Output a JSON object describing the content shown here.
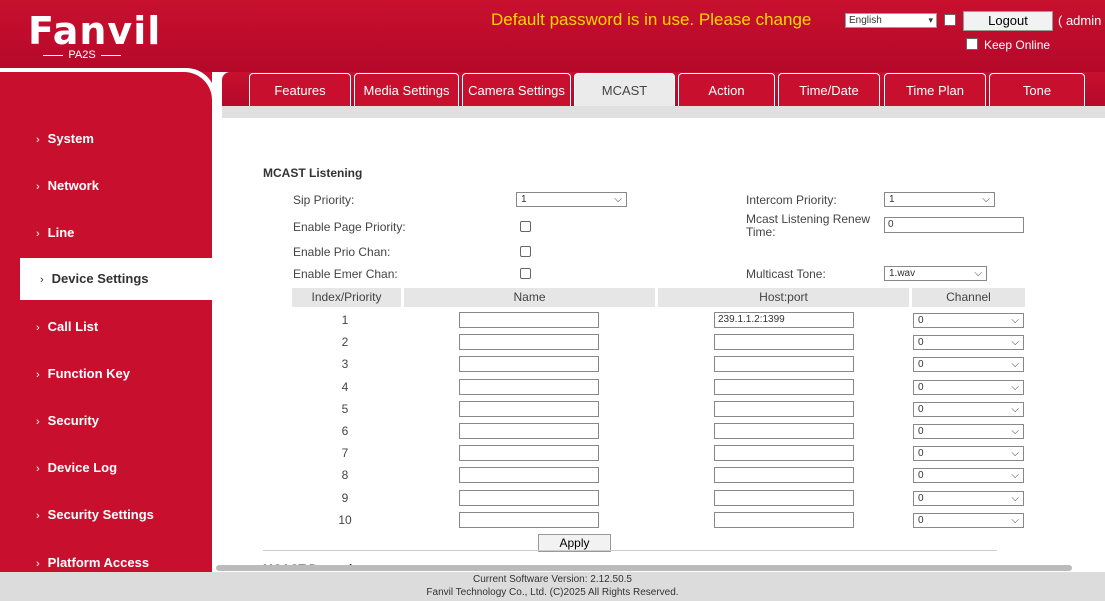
{
  "header": {
    "logo": "Fanvil",
    "model": "PA2S",
    "warning": "Default password is in use. Please change",
    "language": "English",
    "logout_label": "Logout",
    "admin_text": "( admin",
    "keep_online_label": "Keep Online"
  },
  "sidebar": {
    "items": [
      {
        "label": "System"
      },
      {
        "label": "Network"
      },
      {
        "label": "Line"
      },
      {
        "label": "Device Settings"
      },
      {
        "label": "Call List"
      },
      {
        "label": "Function Key"
      },
      {
        "label": "Security"
      },
      {
        "label": "Device Log"
      },
      {
        "label": "Security Settings"
      },
      {
        "label": "Platform Access"
      }
    ],
    "chevron": "›",
    "active_index": 3
  },
  "tabs": [
    {
      "label": "Features"
    },
    {
      "label": "Media Settings"
    },
    {
      "label": "Camera Settings"
    },
    {
      "label": "MCAST"
    },
    {
      "label": "Action"
    },
    {
      "label": "Time/Date"
    },
    {
      "label": "Time Plan"
    },
    {
      "label": "Tone"
    }
  ],
  "mcast": {
    "section_title": "MCAST Listening",
    "sip_priority_label": "Sip Priority:",
    "sip_priority_value": "1",
    "intercom_priority_label": "Intercom Priority:",
    "intercom_priority_value": "1",
    "enable_page_priority_label": "Enable Page Priority:",
    "renew_time_label_1": "Mcast Listening Renew",
    "renew_time_label_2": "Time:",
    "renew_time_value": "0",
    "enable_prio_chan_label": "Enable Prio Chan:",
    "enable_emer_chan_label": "Enable Emer Chan:",
    "multicast_tone_label": "Multicast Tone:",
    "multicast_tone_value": "1.wav",
    "table": {
      "headers": [
        "Index/Priority",
        "Name",
        "Host:port",
        "Channel"
      ],
      "rows": [
        {
          "index": "1",
          "name": "",
          "host": "239.1.1.2:1399",
          "channel": "0"
        },
        {
          "index": "2",
          "name": "",
          "host": "",
          "channel": "0"
        },
        {
          "index": "3",
          "name": "",
          "host": "",
          "channel": "0"
        },
        {
          "index": "4",
          "name": "",
          "host": "",
          "channel": "0"
        },
        {
          "index": "5",
          "name": "",
          "host": "",
          "channel": "0"
        },
        {
          "index": "6",
          "name": "",
          "host": "",
          "channel": "0"
        },
        {
          "index": "7",
          "name": "",
          "host": "",
          "channel": "0"
        },
        {
          "index": "8",
          "name": "",
          "host": "",
          "channel": "0"
        },
        {
          "index": "9",
          "name": "",
          "host": "",
          "channel": "0"
        },
        {
          "index": "10",
          "name": "",
          "host": "",
          "channel": "0"
        }
      ]
    },
    "apply_label": "Apply",
    "dynamic_title": "MCAST Dynamic"
  },
  "footer": {
    "version": "Current Software Version: 2.12.50.5",
    "copyright": "Fanvil Technology Co., Ltd. (C)2025 All Rights Reserved."
  },
  "icons": {
    "dropdown": "chevron-down-icon",
    "sidebar_arrow": "chevron-right-icon"
  },
  "colors": {
    "brand_red": "#c8102e",
    "warning_yellow": "#ffd700"
  }
}
